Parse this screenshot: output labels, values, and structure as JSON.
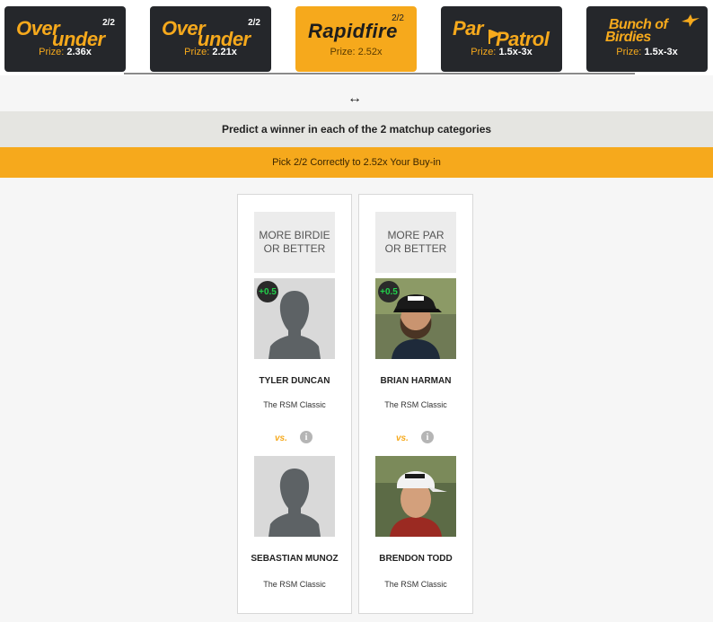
{
  "tabs": [
    {
      "name_line1": "Over",
      "name_line2": "under",
      "count": "2/2",
      "prize_label": "Prize:",
      "prize_value": "2.36x",
      "active": false
    },
    {
      "name_line1": "Over",
      "name_line2": "under",
      "count": "2/2",
      "prize_label": "Prize:",
      "prize_value": "2.21x",
      "active": false
    },
    {
      "name": "Rapidfire",
      "count": "2/2",
      "prize_label": "Prize:",
      "prize_value": "2.52x",
      "active": true
    },
    {
      "name_line1": "Par",
      "name_line2": "Patrol",
      "prize_label": "Prize:",
      "prize_value": "1.5x-3x",
      "active": false
    },
    {
      "name_line1": "Bunch of",
      "name_line2": "Birdies",
      "prize_label": "Prize:",
      "prize_value": "1.5x-3x",
      "active": false
    }
  ],
  "resize_icon": "↔",
  "instruction": "Predict a winner in each of the 2 matchup categories",
  "pick_banner": "Pick 2/2 Correctly to 2.52x Your Buy-in",
  "matchups": [
    {
      "category": "MORE BIRDIE OR BETTER",
      "handicap": "+0.5",
      "vs_label": "vs.",
      "player1": {
        "name": "TYLER DUNCAN",
        "event": "The RSM Classic",
        "photo": "silhouette"
      },
      "player2": {
        "name": "SEBASTIAN MUNOZ",
        "event": "The RSM Classic",
        "photo": "silhouette"
      }
    },
    {
      "category": "MORE PAR OR BETTER",
      "handicap": "+0.5",
      "vs_label": "vs.",
      "player1": {
        "name": "BRIAN HARMAN",
        "event": "The RSM Classic",
        "photo": "headshot"
      },
      "player2": {
        "name": "BRENDON TODD",
        "event": "The RSM Classic",
        "photo": "headshot"
      }
    }
  ],
  "colors": {
    "accent": "#f6a91c",
    "tab_dark": "#25272b",
    "badge_green": "#21d14a"
  }
}
